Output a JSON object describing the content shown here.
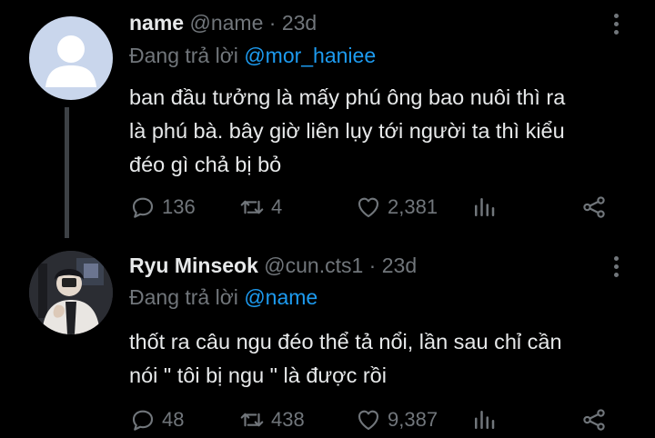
{
  "tweets": [
    {
      "display_name": "name",
      "handle": "@name",
      "time": "23d",
      "reply_prefix": "Đang trả lời",
      "reply_to": "@mor_haniee",
      "text_lines": [
        "ban đầu tưởng là mấy phú ông bao nuôi thì ra",
        "là phú bà. bây giờ liên lụy tới người ta thì kiểu",
        "đéo gì chả bị bỏ"
      ],
      "replies": "136",
      "retweets": "4",
      "likes": "2,381",
      "avatar": "default-avatar"
    },
    {
      "display_name": "Ryu Minseok",
      "handle": "@cun.cts1",
      "time": "23d",
      "reply_prefix": "Đang trả lời",
      "reply_to": "@name",
      "text_lines": [
        "thốt ra câu ngu đéo thể tả nổi, lần sau chỉ cần",
        "nói \" tôi bị ngu \" là được rồi"
      ],
      "replies": "48",
      "retweets": "438",
      "likes": "9,387",
      "avatar": "photo-avatar"
    }
  ],
  "colors": {
    "background": "#000000",
    "text": "#e7e9ea",
    "muted": "#71767b",
    "link": "#1d9bf0",
    "thread_line": "#3d4145"
  }
}
